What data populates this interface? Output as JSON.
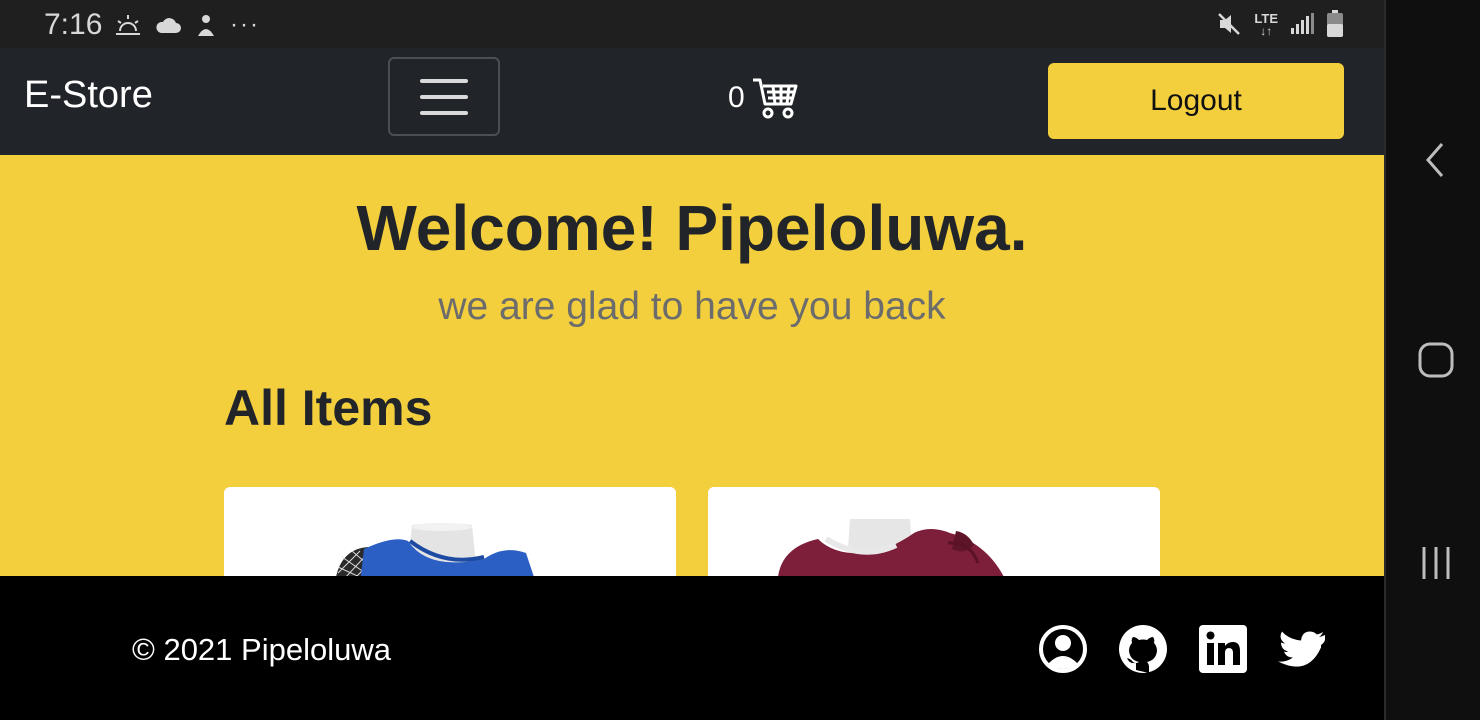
{
  "status_bar": {
    "time": "7:16",
    "left_icons": [
      "weather-sunrise-icon",
      "cloud-icon",
      "app-notification-icon"
    ],
    "more_indicator": "···",
    "network_label": "LTE",
    "right_icons": [
      "mute-icon",
      "signal-icon",
      "battery-icon"
    ]
  },
  "navbar": {
    "brand": "E-Store",
    "menu_icon": "hamburger-menu-icon",
    "cart_count": "0",
    "cart_icon": "shopping-cart-icon",
    "logout_label": "Logout"
  },
  "hero": {
    "title": "Welcome! Pipeloluwa.",
    "subtitle": "we are glad to have you back"
  },
  "items": {
    "heading": "All Items",
    "cards": [
      {
        "image": "blue-top-on-mannequin"
      },
      {
        "image": "burgundy-top-on-mannequin"
      }
    ]
  },
  "footer": {
    "copyright": "© 2021 Pipeloluwa",
    "social_icons": [
      "user-circle-icon",
      "github-icon",
      "linkedin-icon",
      "twitter-icon"
    ]
  },
  "system_nav": [
    "back-icon",
    "home-icon",
    "recent-apps-icon"
  ],
  "colors": {
    "navbar_bg": "#212529",
    "accent_yellow": "#f3cf3e",
    "footer_bg": "#000000"
  }
}
